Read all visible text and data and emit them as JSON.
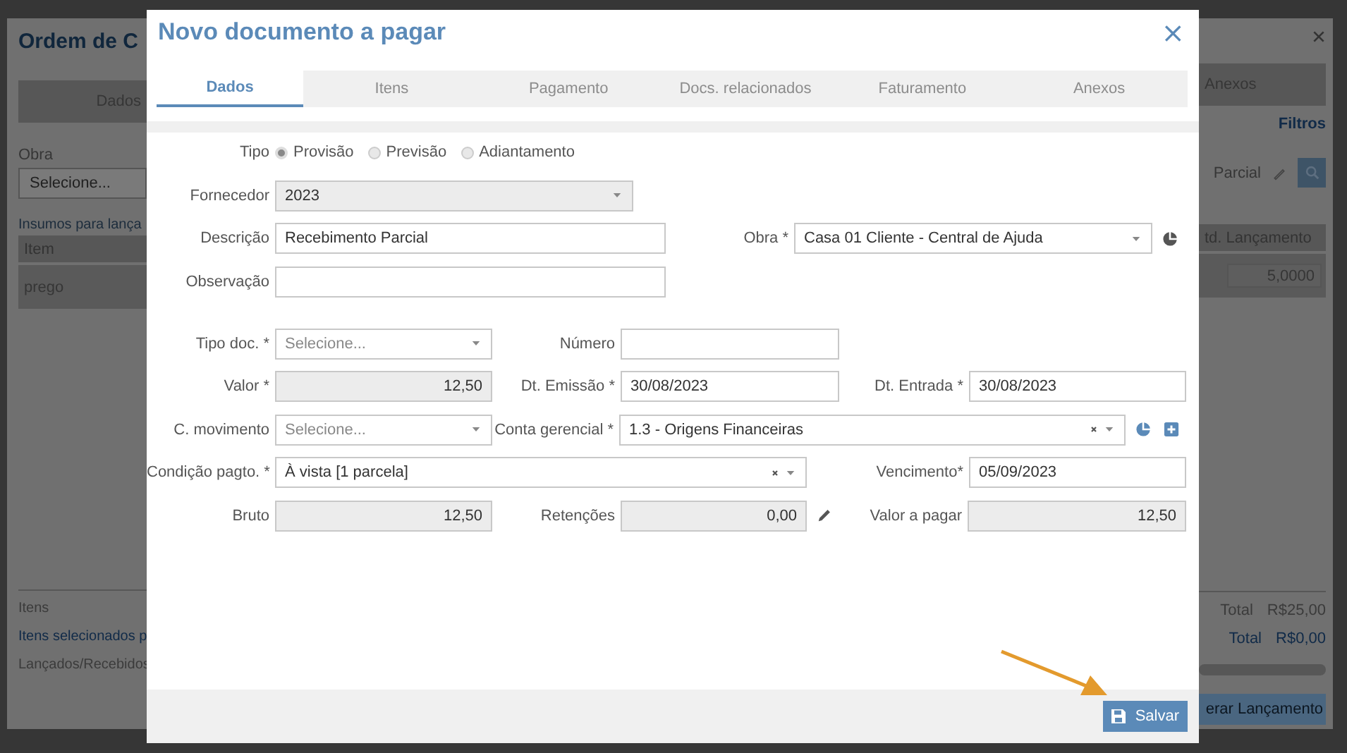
{
  "background": {
    "title": "Ordem de C",
    "tabs": [
      {
        "label": "Dados"
      },
      {
        "label": "Anexos"
      }
    ],
    "filters": "Filtros",
    "obra_label": "Obra",
    "obra_placeholder": "Selecione...",
    "section_title": "Insumos para lança",
    "search_text": "Parcial",
    "table": {
      "columns": [
        "Item",
        "td. Lançamento"
      ],
      "rows": [
        {
          "item": "prego",
          "quantity": "5,0000"
        }
      ]
    },
    "summary": [
      {
        "label": "Itens",
        "total_label": "Total",
        "total": "R$25,00",
        "highlight": false
      },
      {
        "label": "Itens selecionados p",
        "total_label": "Total",
        "total": "R$0,00",
        "highlight": true
      },
      {
        "label": "Lançados/Recebidos",
        "highlight": false
      }
    ],
    "button": "erar Lançamento"
  },
  "dialog": {
    "title": "Novo documento a pagar",
    "close": "×",
    "tabs": [
      {
        "label": "Dados",
        "selected": true
      },
      {
        "label": "Itens",
        "selected": false
      },
      {
        "label": "Pagamento",
        "selected": false
      },
      {
        "label": "Docs. relacionados",
        "selected": false
      },
      {
        "label": "Faturamento",
        "selected": false
      },
      {
        "label": "Anexos",
        "selected": false
      }
    ],
    "tipo": {
      "label": "Tipo",
      "options": [
        {
          "label": "Provisão",
          "selected": true
        },
        {
          "label": "Previsão",
          "selected": false
        },
        {
          "label": "Adiantamento",
          "selected": false
        }
      ]
    },
    "rows": [
      [
        {
          "label": "Fornecedor",
          "kind": "select",
          "value": "2023",
          "disabled": true
        }
      ],
      [
        {
          "label": "Descrição",
          "kind": "input",
          "value": "Recebimento Parcial",
          "disabled": false
        },
        {
          "label": "Obra *",
          "kind": "select",
          "value": "Casa 01 Cliente - Central de Ajuda",
          "disabled": false
        }
      ],
      [
        {
          "label": "Observação",
          "kind": "input",
          "disabled": false
        }
      ],
      [
        {
          "label": "Tipo doc. *",
          "kind": "select",
          "placeholder": "Selecione...",
          "disabled": false
        },
        {
          "label": "Número",
          "kind": "input",
          "disabled": false
        }
      ],
      [
        {
          "label": "Valor *",
          "kind": "number",
          "value": "12,50",
          "disabled": true
        },
        {
          "label": "Dt. Emissão *",
          "kind": "input",
          "value": "30/08/2023",
          "disabled": false
        },
        {
          "label": "Dt. Entrada *",
          "kind": "input",
          "value": "30/08/2023",
          "disabled": false
        }
      ],
      [
        {
          "label": "C. movimento",
          "kind": "select",
          "placeholder": "Selecione...",
          "disabled": false
        },
        {
          "label": "Conta gerencial *",
          "kind": "select",
          "value": "1.3 - Origens Financeiras",
          "clearable": true,
          "disabled": false
        }
      ],
      [
        {
          "label": "Condição pagto. *",
          "kind": "select",
          "value": "À vista [1 parcela]",
          "clearable": true,
          "disabled": false
        },
        {
          "label": "Vencimento*",
          "kind": "input",
          "value": "05/09/2023",
          "disabled": false
        }
      ],
      [
        {
          "label": "Bruto",
          "kind": "number",
          "value": "12,50",
          "disabled": true
        },
        {
          "label": "Retenções",
          "kind": "number",
          "value": "0,00",
          "disabled": true
        },
        {
          "label": "Valor a pagar",
          "kind": "number",
          "value": "12,50",
          "disabled": true
        }
      ]
    ],
    "save_button": "Salvar"
  }
}
